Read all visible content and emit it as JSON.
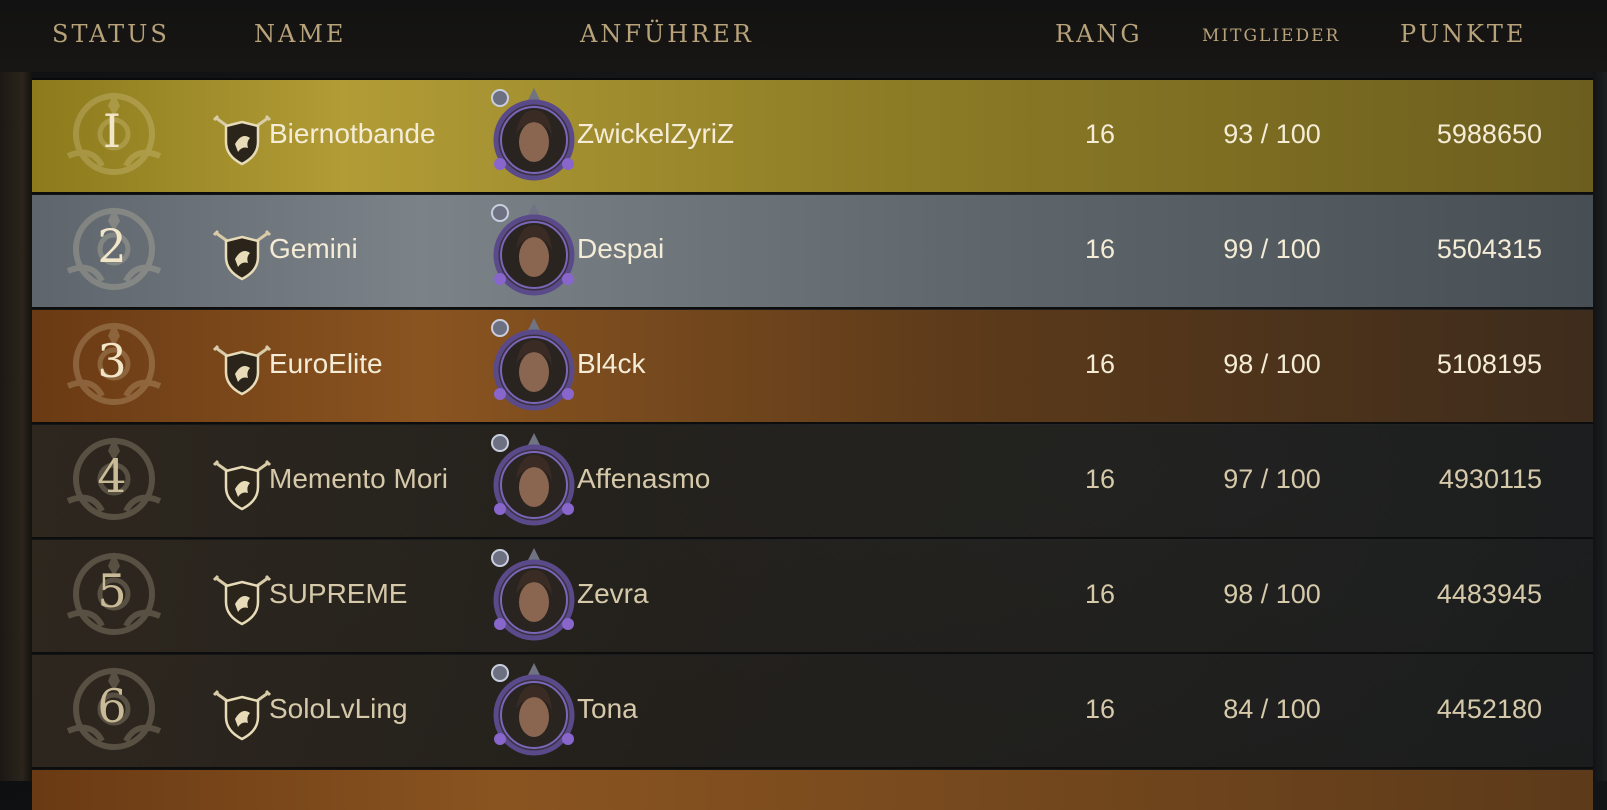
{
  "header": {
    "status": "STATUS",
    "name": "NAME",
    "leader": "ANFÜHRER",
    "rank": "RANG",
    "members": "MITGLIEDER",
    "points": "PUNKTE"
  },
  "rows": [
    {
      "position": "I",
      "tier": "gold",
      "guild": "Biernotbande",
      "leader": "ZwickelZyriZ",
      "rang": "16",
      "members": "93 / 100",
      "points": "5988650"
    },
    {
      "position": "2",
      "tier": "silver",
      "guild": "Gemini",
      "leader": "Despai",
      "rang": "16",
      "members": "99 / 100",
      "points": "5504315"
    },
    {
      "position": "3",
      "tier": "bronze",
      "guild": "EuroElite",
      "leader": "Bl4ck",
      "rang": "16",
      "members": "98 / 100",
      "points": "5108195"
    },
    {
      "position": "4",
      "tier": "plain",
      "guild": "Memento Mori",
      "leader": "Affenasmo",
      "rang": "16",
      "members": "97 / 100",
      "points": "4930115"
    },
    {
      "position": "5",
      "tier": "plain",
      "guild": "SUPREME",
      "leader": "Zevra",
      "rang": "16",
      "members": "98 / 100",
      "points": "4483945"
    },
    {
      "position": "6",
      "tier": "plain",
      "guild": "SoloLvLing",
      "leader": "Tona",
      "rang": "16",
      "members": "84 / 100",
      "points": "4452180"
    }
  ],
  "icons": {
    "guild_crest": "guild-shield-icon",
    "leader_portrait": "leader-avatar-icon",
    "rank_emblem": "rank-emblem-icon"
  },
  "colors": {
    "gold": "#b19c36",
    "silver": "#7b8389",
    "bronze": "#8a5420",
    "header_text": "#b7a27a",
    "row_text": "#f4ecd6"
  }
}
